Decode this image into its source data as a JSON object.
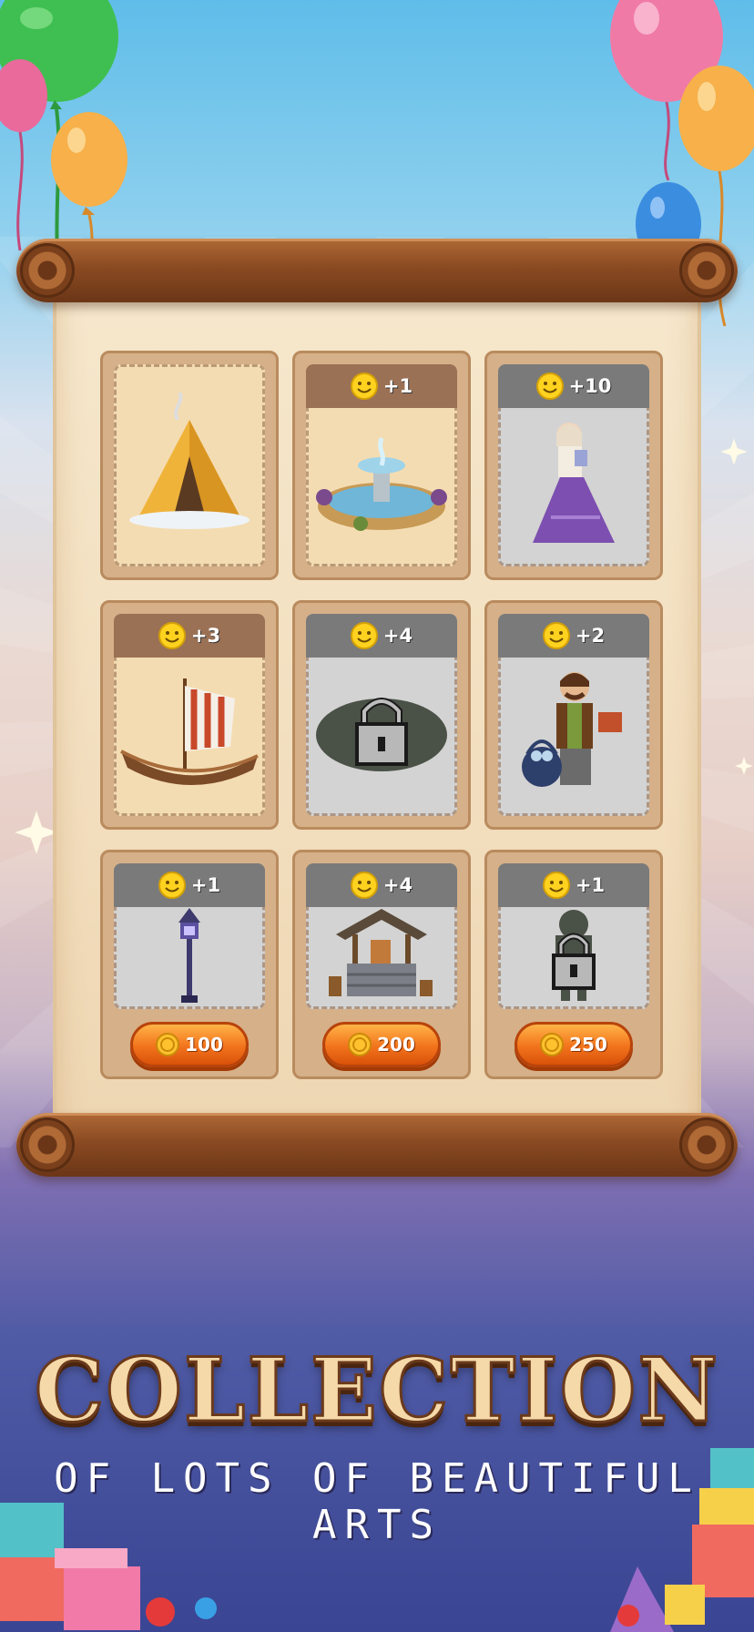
{
  "collection": {
    "cards": [
      {
        "id": "tent",
        "name": "tent-card",
        "art": "tent",
        "theme": "beige",
        "bonus": null,
        "price": null
      },
      {
        "id": "fountain",
        "name": "fountain-card",
        "art": "fountain",
        "theme": "beige",
        "bonus": "+1",
        "price": null
      },
      {
        "id": "lady",
        "name": "lady-card",
        "art": "lady-in-dress",
        "theme": "gray",
        "bonus": "+10",
        "price": null
      },
      {
        "id": "ship",
        "name": "ship-card",
        "art": "viking-ship",
        "theme": "beige",
        "bonus": "+3",
        "price": null
      },
      {
        "id": "locked1",
        "name": "locked-card",
        "art": "lock",
        "theme": "gray",
        "bonus": "+4",
        "price": null
      },
      {
        "id": "merchant",
        "name": "merchant-card",
        "art": "merchant",
        "theme": "gray",
        "bonus": "+2",
        "price": null
      },
      {
        "id": "lamp",
        "name": "lamp-card",
        "art": "street-lamp",
        "theme": "gray",
        "bonus": "+1",
        "price": "100"
      },
      {
        "id": "well",
        "name": "well-card",
        "art": "well",
        "theme": "gray",
        "bonus": "+4",
        "price": "200"
      },
      {
        "id": "locked2",
        "name": "locked-card",
        "art": "lock",
        "theme": "gray",
        "bonus": "+1",
        "price": "250"
      }
    ]
  },
  "title": "COLLECTION",
  "subtitle": "OF LOTS OF BEAUTIFUL ARTS",
  "icons": {
    "bonus": "smiley-icon",
    "currency": "coin-icon"
  },
  "colors": {
    "accent": "#f2731c",
    "scroll": "#8a4a22",
    "parchment": "#f3e0c1"
  }
}
